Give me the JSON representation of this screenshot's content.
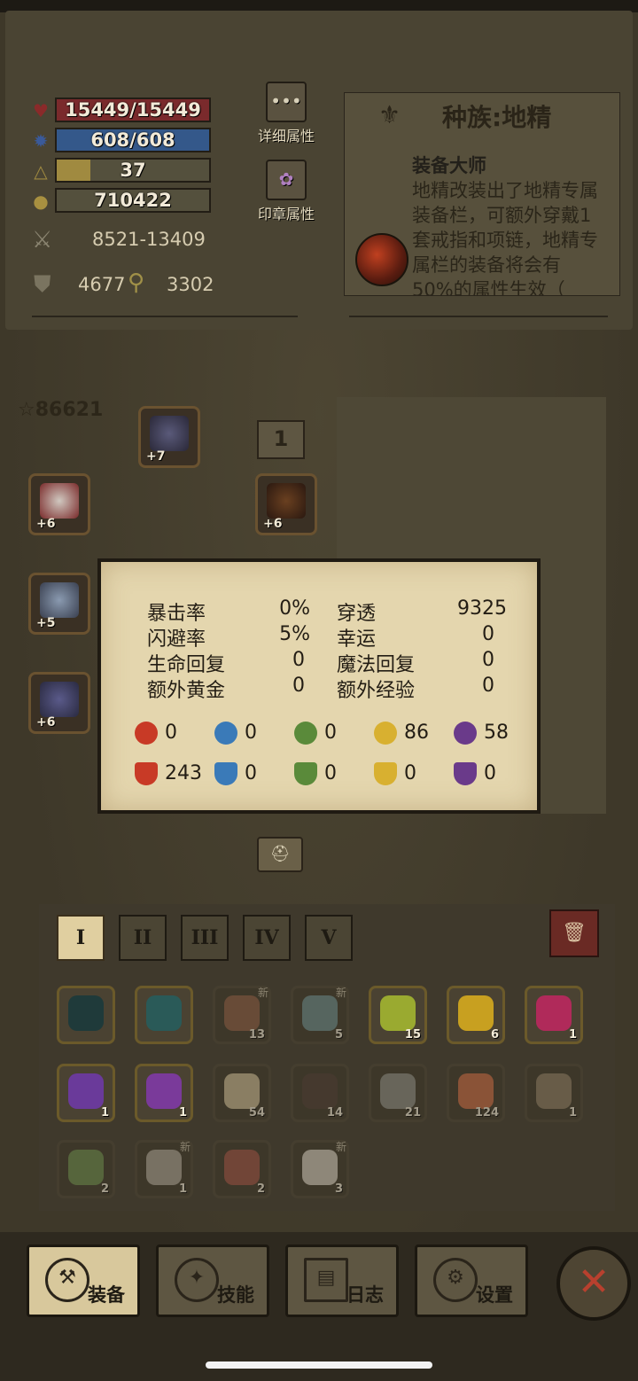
{
  "stats": {
    "hp": "15449/15449",
    "mp": "608/608",
    "level": "37",
    "gold": "710422",
    "attack": "8521-13409",
    "defense": "4677",
    "magic_def": "3302"
  },
  "side_buttons": {
    "detail": "详细属性",
    "seal": "印章属性"
  },
  "race": {
    "title": "种族:地精",
    "subtitle": "装备大师",
    "desc": "地精改装出了地精专属装备栏，可额外穿戴1套戒指和项链，地精专属栏的装备将会有50%的属性生效（"
  },
  "equip": {
    "power": "86621",
    "set_number": "1",
    "slots": [
      {
        "plus": "+7"
      },
      {
        "plus": "+6"
      },
      {
        "plus": "+6"
      },
      {
        "plus": "+5"
      },
      {
        "plus": "+6"
      }
    ]
  },
  "tooltip": {
    "rows": [
      {
        "l1": "暴击率",
        "v1": "0%",
        "l2": "穿透",
        "v2": "9325"
      },
      {
        "l1": "闪避率",
        "v1": "5%",
        "l2": "幸运",
        "v2": "0"
      },
      {
        "l1": "生命回复",
        "v1": "0",
        "l2": "魔法回复",
        "v2": "0"
      },
      {
        "l1": "额外黄金",
        "v1": "0",
        "l2": "额外经验",
        "v2": "0"
      }
    ],
    "elem_attack": [
      "0",
      "0",
      "0",
      "86",
      "58"
    ],
    "elem_resist": [
      "243",
      "0",
      "0",
      "0",
      "0"
    ]
  },
  "tabs": [
    "I",
    "II",
    "III",
    "IV",
    "V"
  ],
  "items": {
    "row1": [
      {
        "count": "",
        "new": ""
      },
      {
        "count": "",
        "new": ""
      },
      {
        "count": "13",
        "new": "新"
      },
      {
        "count": "5",
        "new": "新"
      },
      {
        "count": "15",
        "new": ""
      },
      {
        "count": "6",
        "new": ""
      },
      {
        "count": "1",
        "new": ""
      }
    ],
    "row2": [
      {
        "count": "1",
        "new": ""
      },
      {
        "count": "1",
        "new": ""
      },
      {
        "count": "54",
        "new": ""
      },
      {
        "count": "14",
        "new": ""
      },
      {
        "count": "21",
        "new": ""
      },
      {
        "count": "124",
        "new": ""
      },
      {
        "count": "1",
        "new": ""
      }
    ],
    "row3": [
      {
        "count": "2",
        "new": ""
      },
      {
        "count": "1",
        "new": "新"
      },
      {
        "count": "2",
        "new": ""
      },
      {
        "count": "3",
        "new": "新"
      }
    ]
  },
  "nav": {
    "equip": "装备",
    "skill": "技能",
    "log": "日志",
    "settings": "设置"
  },
  "colors": {
    "hp": "#7a2a2c",
    "mp": "#34588a",
    "xp": "#a08a40",
    "fire": "#c83a26",
    "water": "#3a7ab8",
    "nature": "#5a8a3a",
    "light": "#d8b030",
    "dark": "#6a3a8a"
  }
}
